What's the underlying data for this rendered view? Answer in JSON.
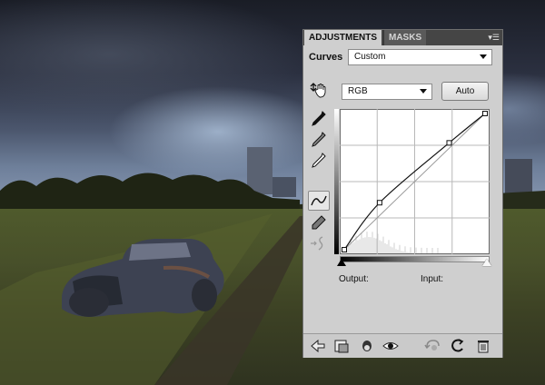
{
  "panel": {
    "tabs": [
      {
        "label": "ADJUSTMENTS",
        "active": true
      },
      {
        "label": "MASKS",
        "active": false
      }
    ],
    "menu_icon": "panel-menu-icon",
    "adjustment_label": "Curves",
    "preset": {
      "value": "Custom"
    },
    "channel": {
      "value": "RGB"
    },
    "auto_label": "Auto",
    "tools": [
      "on-image-adjust-icon",
      "black-point-eyedropper-icon",
      "gray-point-eyedropper-icon",
      "white-point-eyedropper-icon",
      "curve-edit-points-icon",
      "pencil-draw-icon",
      "smooth-curve-icon"
    ],
    "curve": {
      "points": [
        [
          0,
          0
        ],
        [
          64,
          88
        ],
        [
          190,
          200
        ],
        [
          255,
          255
        ]
      ]
    },
    "output_label": "Output:",
    "input_label": "Input:",
    "footer_icons": [
      "back-arrow-icon",
      "clip-to-layer-icon",
      "visibility-layer-icon",
      "eye-icon",
      "view-previous-state-icon",
      "reset-icon",
      "trash-icon"
    ]
  },
  "colors": {
    "panel_bg": "#cfcfcf",
    "tab_bar": "#454545"
  }
}
